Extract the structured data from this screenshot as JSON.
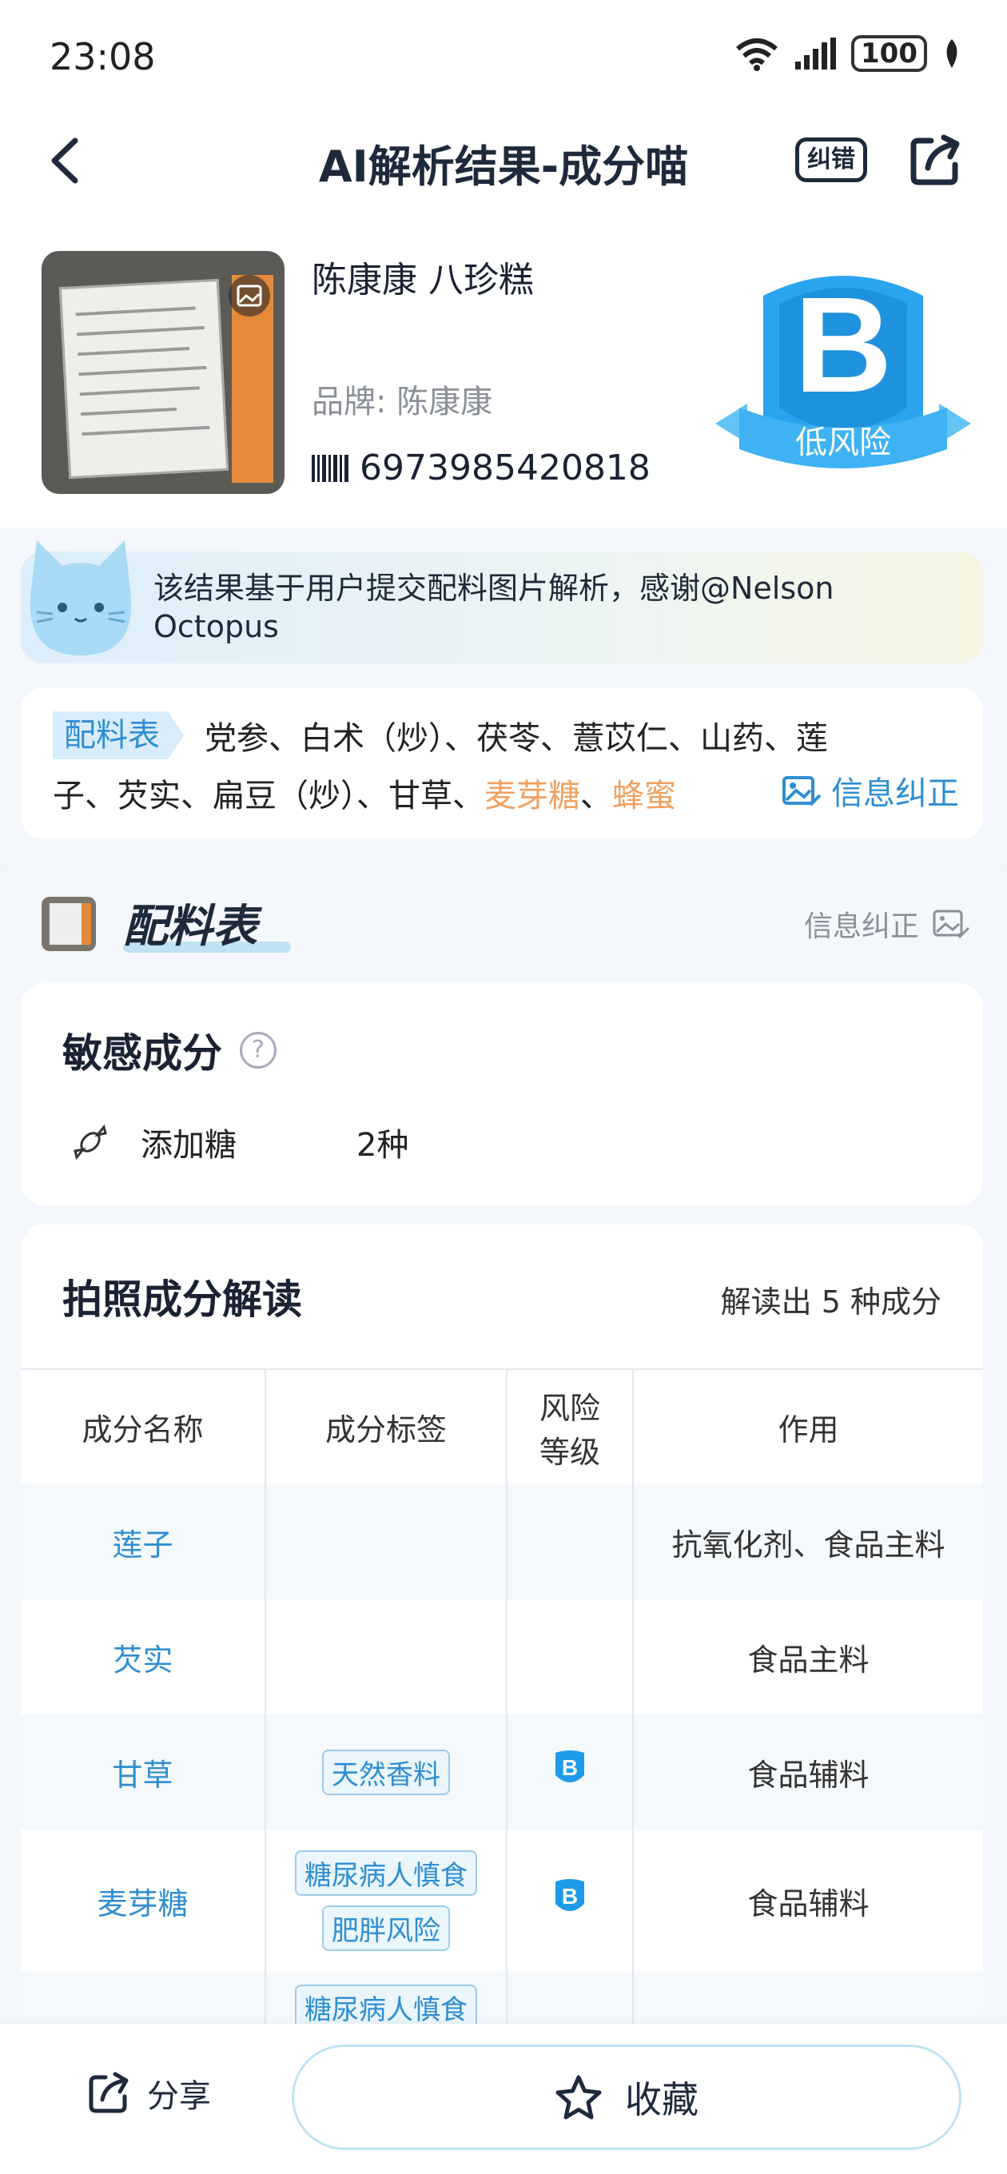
{
  "status": {
    "time": "23:08",
    "battery": "100"
  },
  "nav": {
    "title": "AI解析结果-成分喵",
    "correct_label": "纠错"
  },
  "product": {
    "name": "陈康康 八珍糕",
    "brand_label": "品牌:",
    "brand": "陈康康",
    "barcode": "6973985420818",
    "risk_grade": "B",
    "risk_text": "低风险"
  },
  "notice": {
    "text": "该结果基于用户提交配料图片解析，感谢@Nelson Octopus"
  },
  "ingredients": {
    "tag": "配料表",
    "text_plain": "党参、白术（炒）、茯苓、薏苡仁、山药、莲子、芡实、扁豆（炒）、甘草、",
    "highlight_1": "麦芽糖",
    "separator": "、",
    "highlight_2": "蜂蜜",
    "correct_label": "信息纠正"
  },
  "formula": {
    "title": "配料表",
    "correct_label": "信息纠正"
  },
  "sensitive": {
    "title": "敏感成分",
    "help": "?",
    "items": [
      {
        "name": "添加糖",
        "count": "2种"
      }
    ]
  },
  "table": {
    "title": "拍照成分解读",
    "summary": "解读出 5 种成分",
    "headers": {
      "name": "成分名称",
      "tag": "成分标签",
      "risk_line1": "风险",
      "risk_line2": "等级",
      "effect": "作用"
    },
    "rows": [
      {
        "name": "莲子",
        "tags": [],
        "risk": "",
        "effect": "抗氧化剂、食品主料"
      },
      {
        "name": "芡实",
        "tags": [],
        "risk": "",
        "effect": "食品主料"
      },
      {
        "name": "甘草",
        "tags": [
          "天然香料"
        ],
        "risk": "B",
        "effect": "食品辅料"
      },
      {
        "name": "麦芽糖",
        "tags": [
          "糖尿病人慎食",
          "肥胖风险"
        ],
        "risk": "B",
        "effect": "食品辅料"
      },
      {
        "name": "",
        "tags": [
          "糖尿病人慎食"
        ],
        "risk": "",
        "effect": ""
      }
    ]
  },
  "bottom": {
    "share_label": "分享",
    "favorite_label": "收藏"
  },
  "colors": {
    "accent": "#2f8ed0",
    "highlight": "#f0a060",
    "badge": "#1e9be8"
  }
}
